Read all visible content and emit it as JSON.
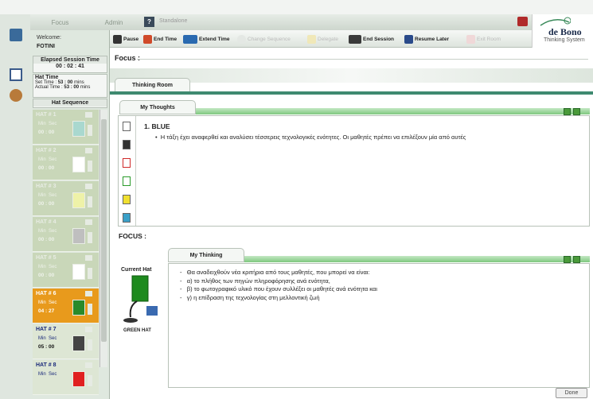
{
  "app": {
    "help_label": "?",
    "mode": "Standalone",
    "brand": "de Bono",
    "brand_sub": "Thinking System"
  },
  "tabs": {
    "focus": "Focus",
    "admin": "Admin"
  },
  "toolbar": {
    "pause": "Pause",
    "end_time": "End Time",
    "extend_time": "Extend Time",
    "change_sequence": "Change Sequence",
    "delegate": "Delegate",
    "end_session": "End Session",
    "resume_later": "Resume Later",
    "exit_room": "Exit Room"
  },
  "sidebar": {
    "welcome": "Welcome:",
    "user": "FOTINI",
    "elapsed_title": "Elapsed Session Time",
    "elapsed_value": "00 : 02 : 41",
    "hat_time_title": "Hat Time",
    "set_time_label": "Set Time :",
    "set_time_value": "53 : 00",
    "actual_time_label": "Actual Time :",
    "actual_time_value": "53 : 00",
    "mins": "mins",
    "hat_sequence_title": "Hat Sequence",
    "min_label": "Min",
    "sec_label": "Sec",
    "hats": [
      {
        "name": "HAT # 1",
        "time": "00 : 00",
        "color": "#a9d8cf"
      },
      {
        "name": "HAT # 2",
        "time": "00 : 00",
        "color": "#ffffff"
      },
      {
        "name": "HAT # 3",
        "time": "00 : 00",
        "color": "#eef2a8"
      },
      {
        "name": "HAT # 4",
        "time": "00 : 00",
        "color": "#bfbfbf"
      },
      {
        "name": "HAT # 5",
        "time": "00 : 00",
        "color": "#ffffff"
      },
      {
        "name": "HAT # 6",
        "time": "04 : 27",
        "color": "#2a8a2a"
      },
      {
        "name": "HAT # 7",
        "time": "05 : 00",
        "color": "#444444"
      },
      {
        "name": "HAT # 8",
        "time": "",
        "color": "#e02020"
      }
    ]
  },
  "main": {
    "focus_label": "Focus :",
    "room_tab": "Thinking Room",
    "my_thoughts_tab": "My Thoughts",
    "thought_title": "1.  BLUE",
    "thought_bullet": "Η τάξη έχει αναφερθεί και αναλύσει τέσσερεις τεχνολογικές ενότητες. Οι μαθητές πρέπει να επιλέξουν μία από αυτές",
    "focus2_label": "FOCUS :",
    "current_hat_label": "Current Hat",
    "green_hat_label": "GREEN HAT",
    "my_thinking_tab": "My Thinking",
    "thinking_lines": [
      "Θα αναδειχθούν νέα κριτήρια από τους μαθητές, που μπορεί να είναι:",
      "α) το πλήθος των πηγών πληροφόρησης ανά ενότητα,",
      "β) το φωτογραφικό υλικό που έχουν συλλέξει οι μαθητές ανά ενότητα και",
      "γ) η επίδραση της τεχνολογίας στη μελλοντική ζωή"
    ],
    "done_label": "Done"
  },
  "colors": {
    "accent": "#3f8a70",
    "active_hat": "#e89a1c",
    "panel_green": "#7fc87f"
  }
}
